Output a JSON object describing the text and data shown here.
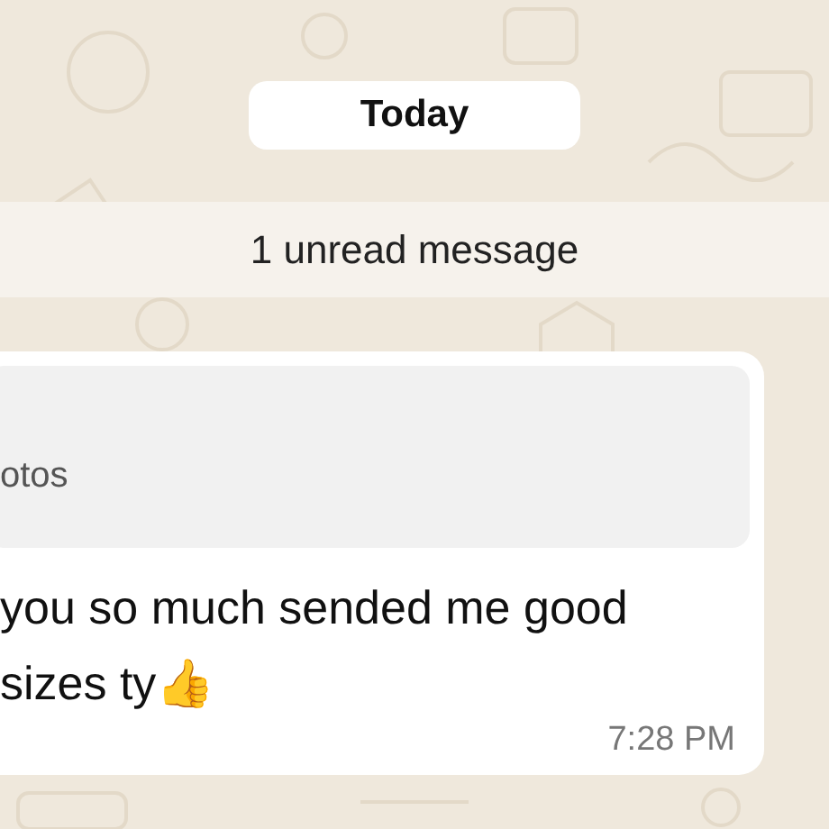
{
  "date_chip": "Today",
  "unread_banner": "1 unread message",
  "message": {
    "quote": {
      "text": "otos"
    },
    "text": "you so much sended me good\nsizes ty👍",
    "time": "7:28 PM"
  }
}
